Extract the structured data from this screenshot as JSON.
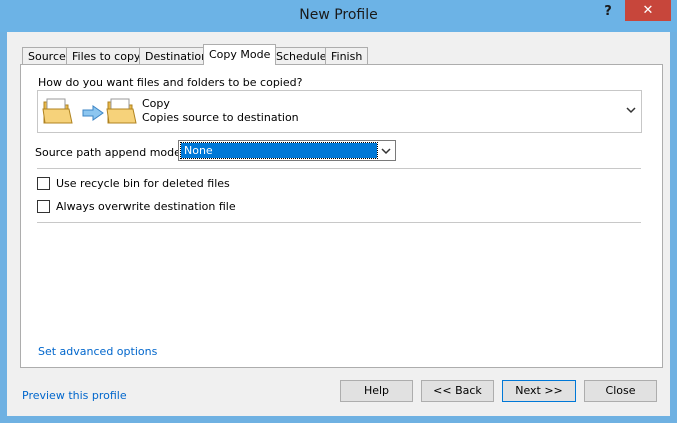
{
  "window": {
    "title": "New Profile",
    "help_glyph": "?",
    "close_glyph": "✕"
  },
  "tabs": [
    {
      "label": "Source",
      "active": false
    },
    {
      "label": "Files to copy",
      "active": false
    },
    {
      "label": "Destination",
      "active": false
    },
    {
      "label": "Copy Mode",
      "active": true
    },
    {
      "label": "Schedule",
      "active": false
    },
    {
      "label": "Finish",
      "active": false
    }
  ],
  "copy_mode": {
    "question": "How do you want files and folders to be copied?",
    "selected_name": "Copy",
    "selected_description": "Copies source to destination",
    "source_icon": "folder-icon",
    "arrow_icon": "right-arrow-icon",
    "dest_icon": "folder-icon"
  },
  "append_mode": {
    "label": "Source path append mode:",
    "value": "None"
  },
  "options": {
    "recycle_bin": {
      "label": "Use recycle bin for deleted files",
      "checked": false
    },
    "overwrite": {
      "label": "Always overwrite destination file",
      "checked": false
    }
  },
  "links": {
    "advanced": "Set advanced options",
    "preview": "Preview this profile"
  },
  "buttons": {
    "help": "Help",
    "back": "<< Back",
    "next": "Next >>",
    "close": "Close"
  },
  "colors": {
    "title_bar": "#6cb3e6",
    "close_button": "#c7463b",
    "selection": "#0078d7",
    "link": "#0066cc"
  }
}
